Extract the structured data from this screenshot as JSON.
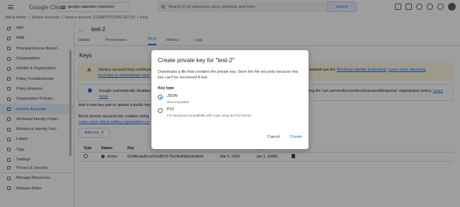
{
  "topbar": {
    "logo": "Google Cloud",
    "project": "google-calendar-connector",
    "search_placeholder": "Search (/) for resources, docs, products, and more",
    "search_button": "Search"
  },
  "breadcrumb": [
    "IAM & Admin",
    "Service accounts",
    "Service account: 111868737010057167119",
    "Keys"
  ],
  "sidebar": {
    "items": [
      {
        "label": "IAM",
        "icon": "person-icon"
      },
      {
        "label": "PAM",
        "icon": "shield-icon"
      },
      {
        "label": "Principal Access Bound...",
        "icon": "shield-icon"
      },
      {
        "label": "Organizations",
        "icon": "organization-icon"
      },
      {
        "label": "Identity & Organization",
        "icon": "person-icon"
      },
      {
        "label": "Policy Troubleshooter",
        "icon": "wrench-icon"
      },
      {
        "label": "Policy Analyzer",
        "icon": "search-icon"
      },
      {
        "label": "Organization Policies",
        "icon": "list-icon"
      },
      {
        "label": "Service Accounts",
        "icon": "account-icon",
        "active": true
      },
      {
        "label": "Workload Identity Feder...",
        "icon": "id-icon"
      },
      {
        "label": "Workforce Identity Fed...",
        "icon": "id-icon"
      },
      {
        "label": "Labels",
        "icon": "tag-icon"
      },
      {
        "label": "Tags",
        "icon": "tag-icon"
      },
      {
        "label": "Settings",
        "icon": "gear-icon"
      },
      {
        "label": "Privacy & Security",
        "icon": "shield-icon"
      }
    ],
    "bottom": [
      {
        "label": "Manage Resources",
        "icon": "folder-icon"
      },
      {
        "label": "Release Notes",
        "icon": "notes-icon"
      }
    ]
  },
  "main": {
    "title": "test-2",
    "tabs": [
      "Details",
      "Permissions",
      "Keys",
      "Metrics",
      "Logs"
    ],
    "active_tab": "Keys",
    "heading": "Keys",
    "warning_left": "Service account keys could po",
    "warning_left2": "best way to authenticate servi",
    "warning_right": "keys and instead use the",
    "warning_link1": "Workload Identity Federation",
    "warning_link2": "Learn more about the",
    "info_left": "Google automatically disables",
    "info_left_link": "more",
    "info_right": "using the 'iam.serviceAccountKeyExposureResponse' organization policy.",
    "info_right_link": "Learn",
    "add_text": "Add a new key pair or upload a public key",
    "block_text": "Block service account key creation using",
    "block_link": "Learn more about setting organization po",
    "add_key_button": "Add key",
    "table": {
      "headers": [
        "Type",
        "Status",
        "Key",
        "Creation date",
        "Expiration date"
      ],
      "rows": [
        {
          "status": "Active",
          "key": "0c546cba33cef37ad872179e1ffa40b8a3edd19",
          "created": "Mar 5, 2025",
          "expires": "Jan 1, 10000"
        }
      ]
    }
  },
  "dialog": {
    "title": "Create private key for \"test-2\"",
    "description": "Downloads a file that contains the private key. Store the file securely because this key can't be recovered if lost.",
    "key_type_label": "Key type",
    "options": [
      {
        "label": "JSON",
        "sub": "Recommended",
        "checked": true
      },
      {
        "label": "P12",
        "sub": "For backward compatibility with code using the P12 format",
        "checked": false
      }
    ],
    "cancel": "Cancel",
    "create": "Create"
  }
}
